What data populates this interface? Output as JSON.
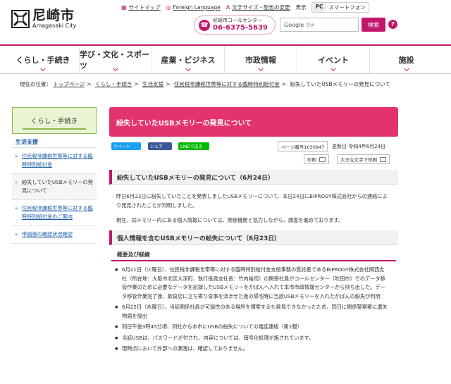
{
  "header": {
    "logo_title": "尼崎市",
    "logo_sub": "Amagasaki City",
    "links": [
      {
        "label": "サイトマップ",
        "icon": "sitemap-icon"
      },
      {
        "label": "Foreign Language",
        "icon": "globe-icon"
      },
      {
        "label": "文字サイズ・配色の変更",
        "icon": "text-size-icon"
      }
    ],
    "display_label": "表示",
    "device_pc": "PC",
    "device_sp": "スマートフォン",
    "callcenter_label": "尼崎市コールセンター",
    "callcenter_number": "06-6375-5639",
    "search_brand": "Google",
    "search_placeholder": "提供",
    "search_button": "検索",
    "help_button": "?"
  },
  "gnav": [
    {
      "label": "くらし・手続き"
    },
    {
      "label": "学び・文化・スポーツ"
    },
    {
      "label": "産業・ビジネス"
    },
    {
      "label": "市政情報"
    },
    {
      "label": "イベント"
    },
    {
      "label": "施設"
    }
  ],
  "breadcrumb": {
    "prefix": "現在の位置：",
    "items": [
      "トップページ",
      "くらし・手続き",
      "生活支援",
      "住民税非課税世帯等に対する臨時特別給付金"
    ],
    "current": "紛失していたUSBメモリーの発見について"
  },
  "sidebar": {
    "head": "くらし・手続き",
    "sub": "生活支援",
    "items": [
      {
        "label": "住民税非課税世帯等に対する臨時特別給付金",
        "type": "link"
      },
      {
        "label": "紛失していたUSBメモリーの発見について",
        "type": "current"
      },
      {
        "label": "住民税非課税世帯等に対する臨時特別給付金のご案内",
        "type": "link"
      },
      {
        "label": "申請後の確認状況確認",
        "type": "link"
      }
    ]
  },
  "main": {
    "title": "紛失していたUSBメモリーの発見について",
    "share_twitter": "ツイート",
    "share_facebook": "シェア",
    "share_line": "LINEで送る",
    "page_number": "ページ番号1030947",
    "updated": "更新日 令和4年6月24日",
    "print": "印刷",
    "big_print": "大きな文字で印刷",
    "section1_title": "紛失していたUSBメモリーの発見について（6月24日）",
    "section1_p1": "昨日6月23日に紛失していたことを発表しましたUSBメモリーについて、本日24日にBIPROGY株式会社からの連絡により発見されたことが判明しました。",
    "section1_p2": "現在、同メモリー内にある個人情報については、関係機関と協力しながら、調査を進めております。",
    "section2_title": "個人情報を含むUSBメモリーの紛失について（6月23日）",
    "section2_sub": "概要及び経緯",
    "bullets": [
      "6月21日（火曜日）、住民税非課税世帯等に対する臨時特別給付金支給事務の受託者であるBIPROGY株式会社関西支社（所在地：大阪市北区大深町、執行役員支社長：竹内裕司）の関係社員がコールセンター（吹田市）でのデータ移管作業のために必要なデータを記録したUSBメモリーをかばんへ入れて本市市政情報センターから持ち出した。データ移管作業完了後、飲食店に立ち寄り食事を済ませた後の帰宅時に当該USBメモリーを入れたかばんの紛失が判明",
      "6月22日（水曜日）、当該関係社員が可能性のある場所を捜索するも発見できなかったため、同日に関係警察署に遺失物届を提出",
      "同日午後3時45分頃、同社から本市にUSBの紛失についての電話連絡（第1報）",
      "当該USBは、パスワードが付され、内容については、暗号化処理が施されています。",
      "現時点において外部への漏洩は、確認しておりません。"
    ]
  },
  "colors": {
    "accent": "#c0186a",
    "title_bg": "#e3336e",
    "sidebar_green": "#8bbb52",
    "link_blue": "#1a5ca8"
  }
}
